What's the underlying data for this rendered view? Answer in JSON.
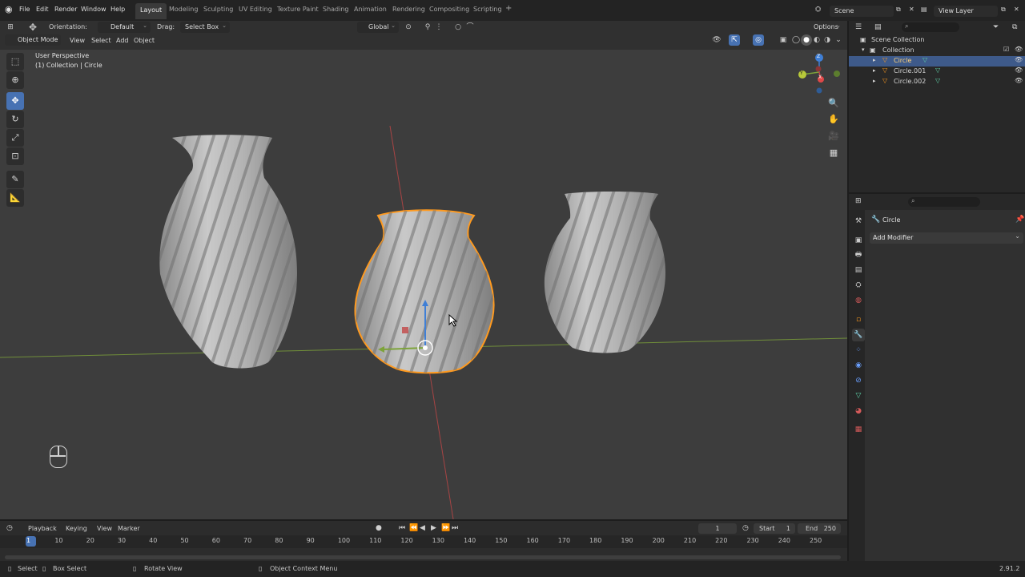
{
  "menu": [
    "File",
    "Edit",
    "Render",
    "Window",
    "Help"
  ],
  "workspaces": [
    "Layout",
    "Modeling",
    "Sculpting",
    "UV Editing",
    "Texture Paint",
    "Shading",
    "Animation",
    "Rendering",
    "Compositing",
    "Scripting"
  ],
  "add_workspace": "+",
  "scene": {
    "name": "Scene",
    "view_layer": "View Layer"
  },
  "toolbar": {
    "orientation_label": "Orientation:",
    "orientation_value": "Default",
    "drag_label": "Drag:",
    "drag_value": "Select Box",
    "transform_value": "Global",
    "options_label": "Options"
  },
  "header": {
    "mode": "Object Mode",
    "menus": [
      "View",
      "Select",
      "Add",
      "Object"
    ]
  },
  "viewport": {
    "perspective": "User Perspective",
    "context": "(1) Collection | Circle",
    "gizmo_axes": [
      "X",
      "Y",
      "Z"
    ]
  },
  "outliner": {
    "root": "Scene Collection",
    "collection": "Collection",
    "objects": [
      {
        "name": "Circle",
        "selected": true
      },
      {
        "name": "Circle.001",
        "selected": false
      },
      {
        "name": "Circle.002",
        "selected": false
      }
    ]
  },
  "properties": {
    "object_name": "Circle",
    "add_modifier": "Add Modifier"
  },
  "timeline": {
    "menus": [
      "Playback",
      "Keying",
      "View",
      "Marker"
    ],
    "current_frame": "1",
    "start_label": "Start",
    "start": "1",
    "end_label": "End",
    "end": "250",
    "ticks": [
      "1",
      "10",
      "20",
      "30",
      "40",
      "50",
      "60",
      "70",
      "80",
      "90",
      "100",
      "110",
      "120",
      "130",
      "140",
      "150",
      "160",
      "170",
      "180",
      "190",
      "200",
      "210",
      "220",
      "230",
      "240",
      "250"
    ]
  },
  "status": {
    "select": "Select",
    "box_select": "Box Select",
    "rotate_view": "Rotate View",
    "context_menu": "Object Context Menu",
    "version": "2.91.2"
  },
  "colors": {
    "accent": "#4772b3",
    "selection_outline": "#ff9a1f",
    "x_axis": "#c24646",
    "y_axis": "#7da33a",
    "z_axis": "#3f7fd6"
  }
}
